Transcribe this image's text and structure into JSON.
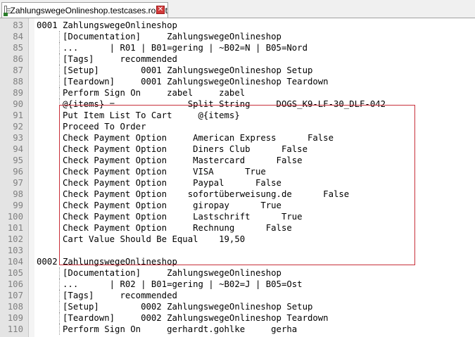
{
  "tab": {
    "title": "ZahlungswegeOnlineshop.testcases.robot",
    "icon": "file-icon",
    "close_icon": "close-icon"
  },
  "colors": {
    "highlight_border": "#c8303a",
    "close_button": "#d23b3b"
  },
  "lines": [
    {
      "n": "83",
      "text": "0001 ZahlungswegeOnlineshop"
    },
    {
      "n": "84",
      "text": "     [Documentation]     ZahlungswegeOnlineshop"
    },
    {
      "n": "85",
      "text": "     ...      | R01 | B01=gering | ~B02=N | B05=Nord"
    },
    {
      "n": "86",
      "text": "     [Tags]     recommended"
    },
    {
      "n": "87",
      "text": "     [Setup]        0001 ZahlungswegeOnlineshop Setup"
    },
    {
      "n": "88",
      "text": "     [Teardown]     0001 ZahlungswegeOnlineshop Teardown"
    },
    {
      "n": "89",
      "text": "     Perform Sign On     zabel     zabel"
    },
    {
      "n": "90",
      "text": "     @{items} =              Split String     DOGS_K9-LF-30_DLF-042"
    },
    {
      "n": "91",
      "text": "     Put Item List To Cart     @{items}"
    },
    {
      "n": "92",
      "text": "     Proceed To Order"
    },
    {
      "n": "93",
      "text": "     Check Payment Option     American Express      False"
    },
    {
      "n": "94",
      "text": "     Check Payment Option     Diners Club      False"
    },
    {
      "n": "95",
      "text": "     Check Payment Option     Mastercard      False"
    },
    {
      "n": "96",
      "text": "     Check Payment Option     VISA      True"
    },
    {
      "n": "97",
      "text": "     Check Payment Option     Paypal      False"
    },
    {
      "n": "98",
      "text": "     Check Payment Option    sofortüberweisung.de      False"
    },
    {
      "n": "99",
      "text": "     Check Payment Option     giropay      True"
    },
    {
      "n": "100",
      "text": "     Check Payment Option     Lastschrift      True"
    },
    {
      "n": "101",
      "text": "     Check Payment Option     Rechnung      False"
    },
    {
      "n": "102",
      "text": "     Cart Value Should Be Equal    19,50"
    },
    {
      "n": "103",
      "text": ""
    },
    {
      "n": "104",
      "text": "0002 ZahlungswegeOnlineshop"
    },
    {
      "n": "105",
      "text": "     [Documentation]     ZahlungswegeOnlineshop"
    },
    {
      "n": "106",
      "text": "     ...      | R02 | B01=gering | ~B02=J | B05=Ost"
    },
    {
      "n": "107",
      "text": "     [Tags]     recommended"
    },
    {
      "n": "108",
      "text": "     [Setup]        0002 ZahlungswegeOnlineshop Setup"
    },
    {
      "n": "109",
      "text": "     [Teardown]     0002 ZahlungswegeOnlineshop Teardown"
    },
    {
      "n": "110",
      "text": "     Perform Sign On     gerhardt.gohlke     gerha"
    }
  ]
}
